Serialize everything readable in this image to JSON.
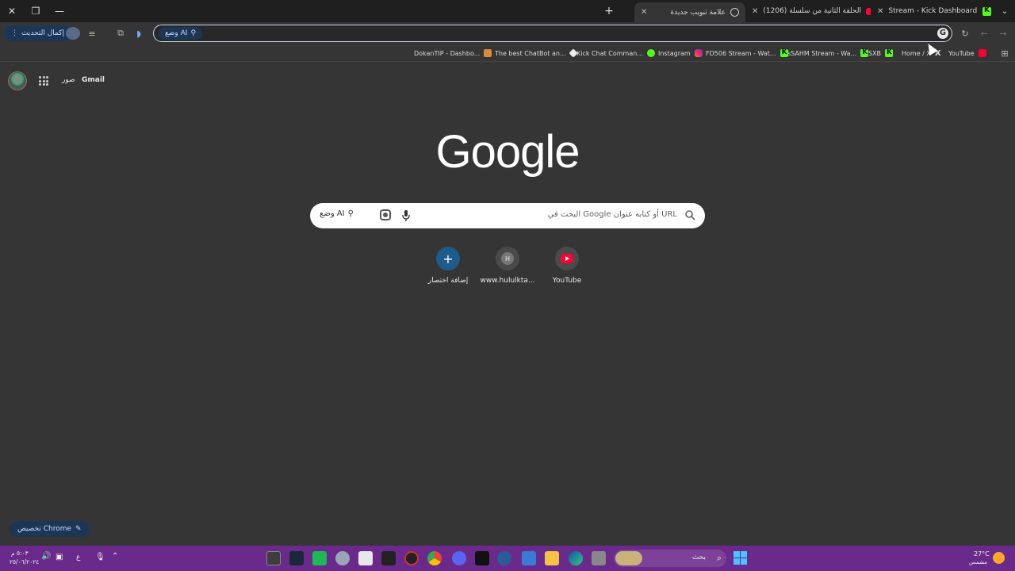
{
  "window_controls": {
    "close": "✕",
    "restore": "❐",
    "minimize": "—"
  },
  "tabs": [
    {
      "title": "Stream - Kick Dashboard",
      "favicon": "kick-icon",
      "close": "✕"
    },
    {
      "title": "(1206) الحلقة الثانية من سلسلة",
      "favicon": "youtube-icon",
      "close": "✕"
    },
    {
      "title": "علامة تبويب جديدة",
      "favicon": "globe-icon",
      "close": "✕"
    }
  ],
  "new_tab": "+",
  "toolbar": {
    "update_label": "إكمال التحديث",
    "ai_mode_label": "وضع AI",
    "address_value": ""
  },
  "bookmarks": [
    {
      "label": "YouTube",
      "icon": "youtube-icon"
    },
    {
      "label": "Home / X",
      "icon": "x-icon"
    },
    {
      "label": "SXB",
      "icon": "kick-icon"
    },
    {
      "label": "sSAHM Stream - Wa...",
      "icon": "kick-icon"
    },
    {
      "label": "FD506 Stream - Wat...",
      "icon": "kick-icon"
    },
    {
      "label": "Instagram",
      "icon": "instagram-icon"
    },
    {
      "label": "Kick Chat Comman...",
      "icon": "kick-icon"
    },
    {
      "label": "The best ChatBot an...",
      "icon": "diamond-icon"
    },
    {
      "label": "DokanTIP - Dashbo...",
      "icon": "shop-icon"
    }
  ],
  "header": {
    "gmail": "Gmail",
    "images": "صور"
  },
  "logo": "Google",
  "search": {
    "placeholder": "البحث في Google أو كتابة عنوان URL",
    "ai_mode_label": "وضع AI"
  },
  "shortcuts": [
    {
      "label": "YouTube",
      "icon": "youtube-icon"
    },
    {
      "label": "www.hululkta...",
      "icon_letter": "H"
    },
    {
      "label": "إضافة اختصار",
      "icon": "plus-icon",
      "glyph": "+"
    }
  ],
  "customize_label": "تخصيص Chrome",
  "taskbar": {
    "weather_temp": "27°C",
    "weather_desc": "مشمس",
    "search_label": "بحث",
    "time": "٥:٠٣ م",
    "date": "٢٥/٠٦/٢٠٢٤",
    "lang": "ع",
    "colors": {
      "bar": "#6a2a8c",
      "accent": "#4cc2ff"
    }
  },
  "colors": {
    "page_bg": "#353535",
    "chip_bg": "#1e3656",
    "chip_text": "#c4dcff"
  }
}
